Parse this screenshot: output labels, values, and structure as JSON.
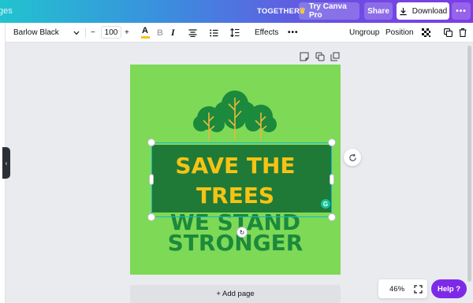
{
  "header": {
    "breadcrumb_fragment": "ges",
    "together_label": "TOGETHER",
    "try_pro_label": "Try Canva Pro",
    "share_label": "Share",
    "download_label": "Download",
    "more_label": "•••"
  },
  "toolbar": {
    "font_name": "Barlow Black",
    "font_size": "100",
    "minus": "−",
    "plus": "+",
    "text_color_label": "A",
    "text_color": "#f5c518",
    "bold": "B",
    "italic": "I",
    "effects_label": "Effects",
    "more": "•••",
    "ungroup_label": "Ungroup",
    "position_label": "Position"
  },
  "canvas": {
    "background_color": "#7ed957",
    "headline_line1": "SAVE THE",
    "headline_line2": "TREES",
    "subline1": "WE STAND",
    "subline2": "STRONGER",
    "banner_color": "#1f7a37",
    "headline_color": "#f6c314",
    "subline_color": "#1b8a3c",
    "add_page_label": "+ Add page"
  },
  "footer": {
    "zoom_level": "46%",
    "help_label": "Help ?"
  },
  "colors": {
    "accent_purple": "#7d2ae8",
    "selection": "#16b7c9"
  }
}
